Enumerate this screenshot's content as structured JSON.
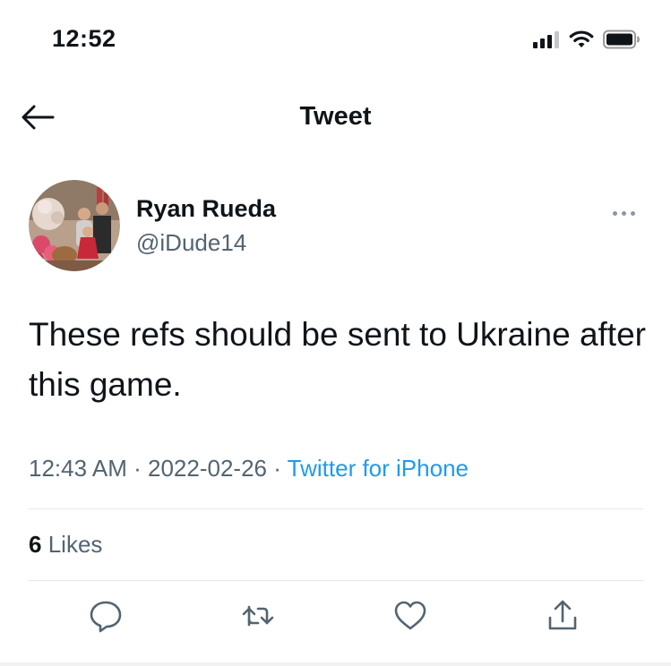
{
  "status_bar": {
    "time": "12:52",
    "icons": [
      "cellular-signal-icon",
      "wifi-icon",
      "battery-icon"
    ]
  },
  "nav": {
    "back_icon": "arrow-left-icon",
    "title": "Tweet"
  },
  "tweet": {
    "author": {
      "display_name": "Ryan Rueda",
      "handle": "@iDude14",
      "avatar_icon": "profile-photo"
    },
    "text": "These refs should be sent to Ukraine after this game.",
    "time": "12:43 AM",
    "separator": "·",
    "date": "2022-02-26",
    "source": "Twitter for iPhone",
    "likes": {
      "count": "6",
      "label": "Likes"
    }
  },
  "actions": {
    "items": [
      "reply-icon",
      "retweet-icon",
      "like-icon",
      "share-icon"
    ]
  },
  "colors": {
    "text": "#0f1419",
    "secondary": "#536471",
    "link": "#1d9bf0",
    "divider": "#e1e8ed"
  }
}
